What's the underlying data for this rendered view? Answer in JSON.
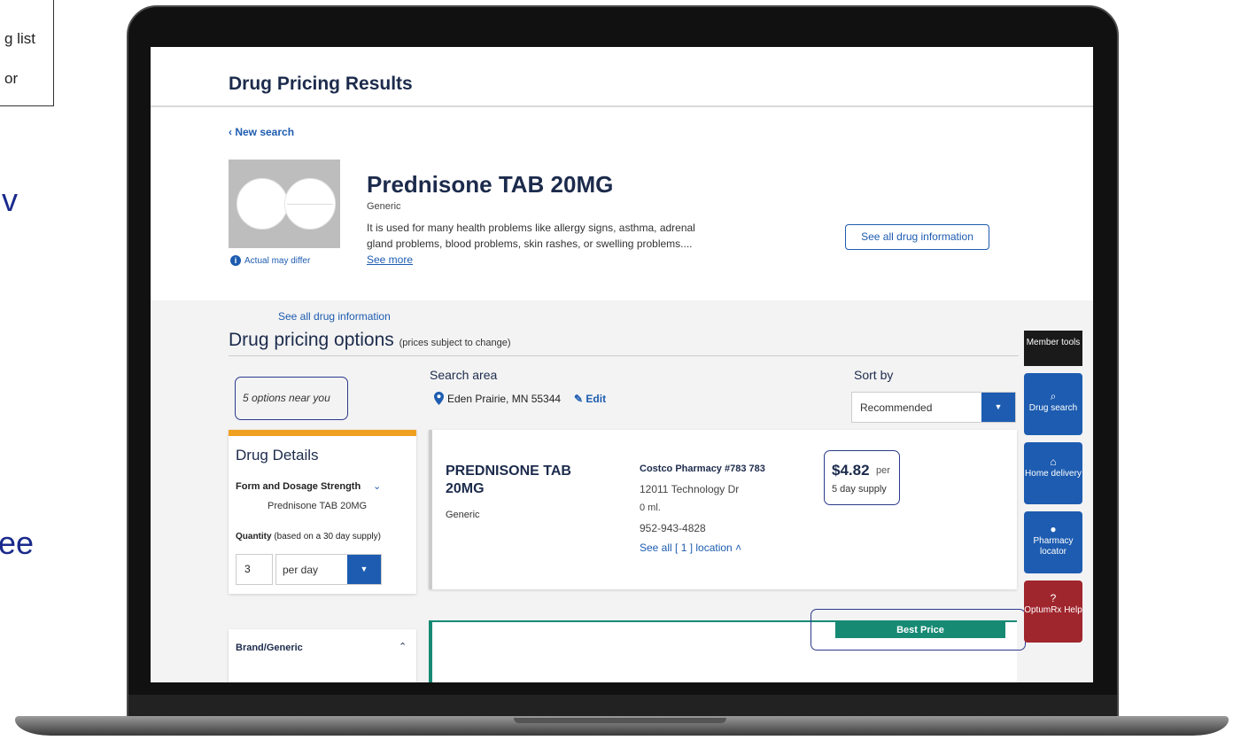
{
  "slide_fragments": {
    "box_line1": "g list",
    "box_line2": "or",
    "blue_text1": "v",
    "blue_text2": "ee"
  },
  "header": {
    "title": "Drug Pricing Results"
  },
  "nav": {
    "back_link": "‹ New search"
  },
  "drug": {
    "image_caption": "Actual may differ",
    "image_caption_icon": "info-icon",
    "name": "Prednisone TAB 20MG",
    "type": "Generic",
    "description": "It is used for many health problems like allergy signs, asthma, adrenal gland problems, blood problems, skin rashes, or swelling problems....",
    "see_more": "See more",
    "see_all_button": "See all drug information"
  },
  "options": {
    "see_all_link": "See all drug information",
    "title": "Drug pricing options",
    "subtitle": "(prices subject to change)",
    "near_you": "5 options near you",
    "search_area_label": "Search area",
    "location": "Eden Prairie, MN 55344",
    "edit": "Edit",
    "sort_label": "Sort by",
    "sort_value": "Recommended"
  },
  "details": {
    "title": "Drug Details",
    "form_label": "Form and Dosage Strength",
    "form_value": "Prednisone TAB 20MG",
    "quantity_label": "Quantity",
    "quantity_note": "(based on a 30 day supply)",
    "quantity_value": "3",
    "quantity_unit": "per day"
  },
  "brand_filter": {
    "label": "Brand/Generic"
  },
  "result": {
    "drug": "PREDNISONE TAB 20MG",
    "type": "Generic",
    "pharmacy": "Costco Pharmacy #783 783",
    "address": "12011 Technology Dr",
    "distance": "0 ml.",
    "phone": "952-943-4828",
    "locations_link": "See all [ 1 ] location",
    "price": "$4.82",
    "price_per": "per",
    "supply": "5 day supply"
  },
  "result2": {
    "badge": "Best Price"
  },
  "tools": {
    "member": "Member tools",
    "drug_search": "Drug search",
    "home_delivery": "Home delivery",
    "pharmacy_locator": "Pharmacy locator",
    "help": "OptumRx Help"
  },
  "colors": {
    "primary_blue": "#1d5cb0",
    "navy": "#1c2b4c",
    "orange_accent": "#f0a020",
    "teal_best_price": "#178a74",
    "help_red": "#a0262d"
  }
}
